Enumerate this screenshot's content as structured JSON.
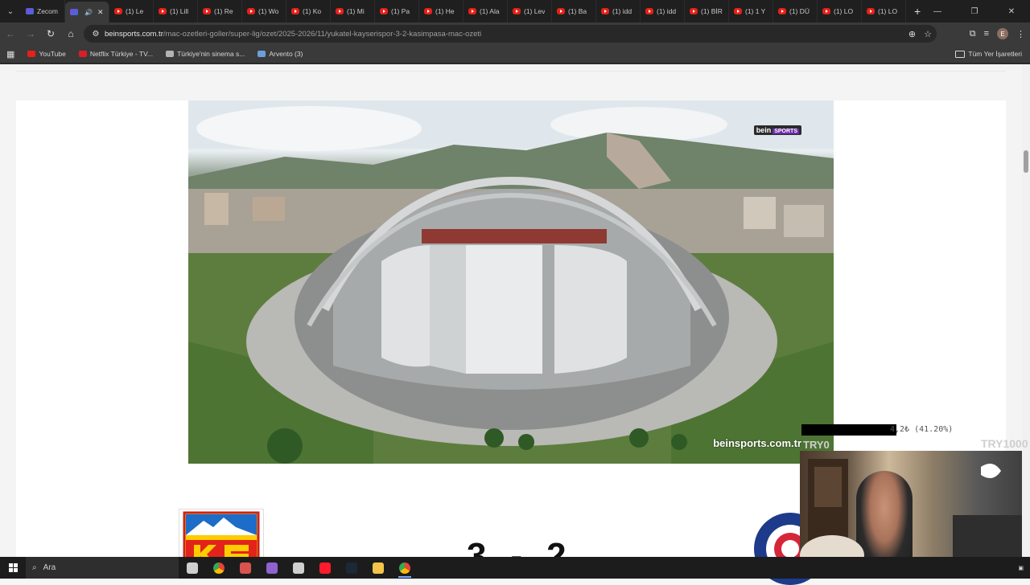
{
  "browser": {
    "tabs": [
      {
        "label": "Zecom",
        "icon": "site",
        "active": false
      },
      {
        "label": "",
        "icon": "site",
        "active": true,
        "sound": true
      },
      {
        "label": "(1) Le",
        "icon": "youtube"
      },
      {
        "label": "(1) Lill",
        "icon": "youtube"
      },
      {
        "label": "(1) Re",
        "icon": "youtube"
      },
      {
        "label": "(1) Wo",
        "icon": "youtube"
      },
      {
        "label": "(1) Ko",
        "icon": "youtube"
      },
      {
        "label": "(1) Mi",
        "icon": "youtube"
      },
      {
        "label": "(1) Pa",
        "icon": "youtube"
      },
      {
        "label": "(1) He",
        "icon": "youtube"
      },
      {
        "label": "(1) Ala",
        "icon": "youtube"
      },
      {
        "label": "(1) Lev",
        "icon": "youtube"
      },
      {
        "label": "(1) Ba",
        "icon": "youtube"
      },
      {
        "label": "(1) idd",
        "icon": "youtube"
      },
      {
        "label": "(1) idd",
        "icon": "youtube"
      },
      {
        "label": "(1) BİR",
        "icon": "youtube"
      },
      {
        "label": "(1) 1 Y",
        "icon": "youtube"
      },
      {
        "label": "(1) DÜ",
        "icon": "youtube"
      },
      {
        "label": "(1) LO",
        "icon": "youtube"
      },
      {
        "label": "(1) LO",
        "icon": "youtube"
      }
    ],
    "url_domain": "beinsports.com.tr",
    "url_path": "/mac-ozetleri-goller/super-lig/ozet/2025-2026/11/yukatel-kayserispor-3-2-kasimpasa-mac-ozeti",
    "profile_initial": "E",
    "bookmarks": [
      {
        "label": "YouTube",
        "color": "#e62117"
      },
      {
        "label": "Netflix Türkiye - TV...",
        "color": "#d81f26"
      },
      {
        "label": "Türkiye'nin sinema s...",
        "color": "#b3b3b3"
      },
      {
        "label": "Arvento (3)",
        "color": "#6aa0d8"
      }
    ],
    "all_bookmarks_label": "Tüm Yer İşaretleri"
  },
  "page": {
    "video": {
      "channel_logo_main": "bein",
      "channel_logo_sub": "SPORTS",
      "watermark": "beinsports.com.tr"
    },
    "score": "3-2"
  },
  "overlay": {
    "progress_text": "4,2₺ (41.20%)",
    "progress_fraction": 0.412,
    "goal_left": "TRY0",
    "goal_right": "TRY1000"
  },
  "taskbar": {
    "search_placeholder": "Ara",
    "apps": [
      {
        "name": "task-view",
        "color": "#cfcfcf"
      },
      {
        "name": "chrome",
        "color": "#4285f4"
      },
      {
        "name": "photos",
        "color": "#d9534f"
      },
      {
        "name": "copilot",
        "color": "#8e63ce"
      },
      {
        "name": "xbox",
        "color": "#cfcfcf"
      },
      {
        "name": "opera",
        "color": "#ff1b2d"
      },
      {
        "name": "steam",
        "color": "#1b2838"
      },
      {
        "name": "files",
        "color": "#f3c34a"
      },
      {
        "name": "chrome-active",
        "color": "#4285f4"
      }
    ]
  }
}
